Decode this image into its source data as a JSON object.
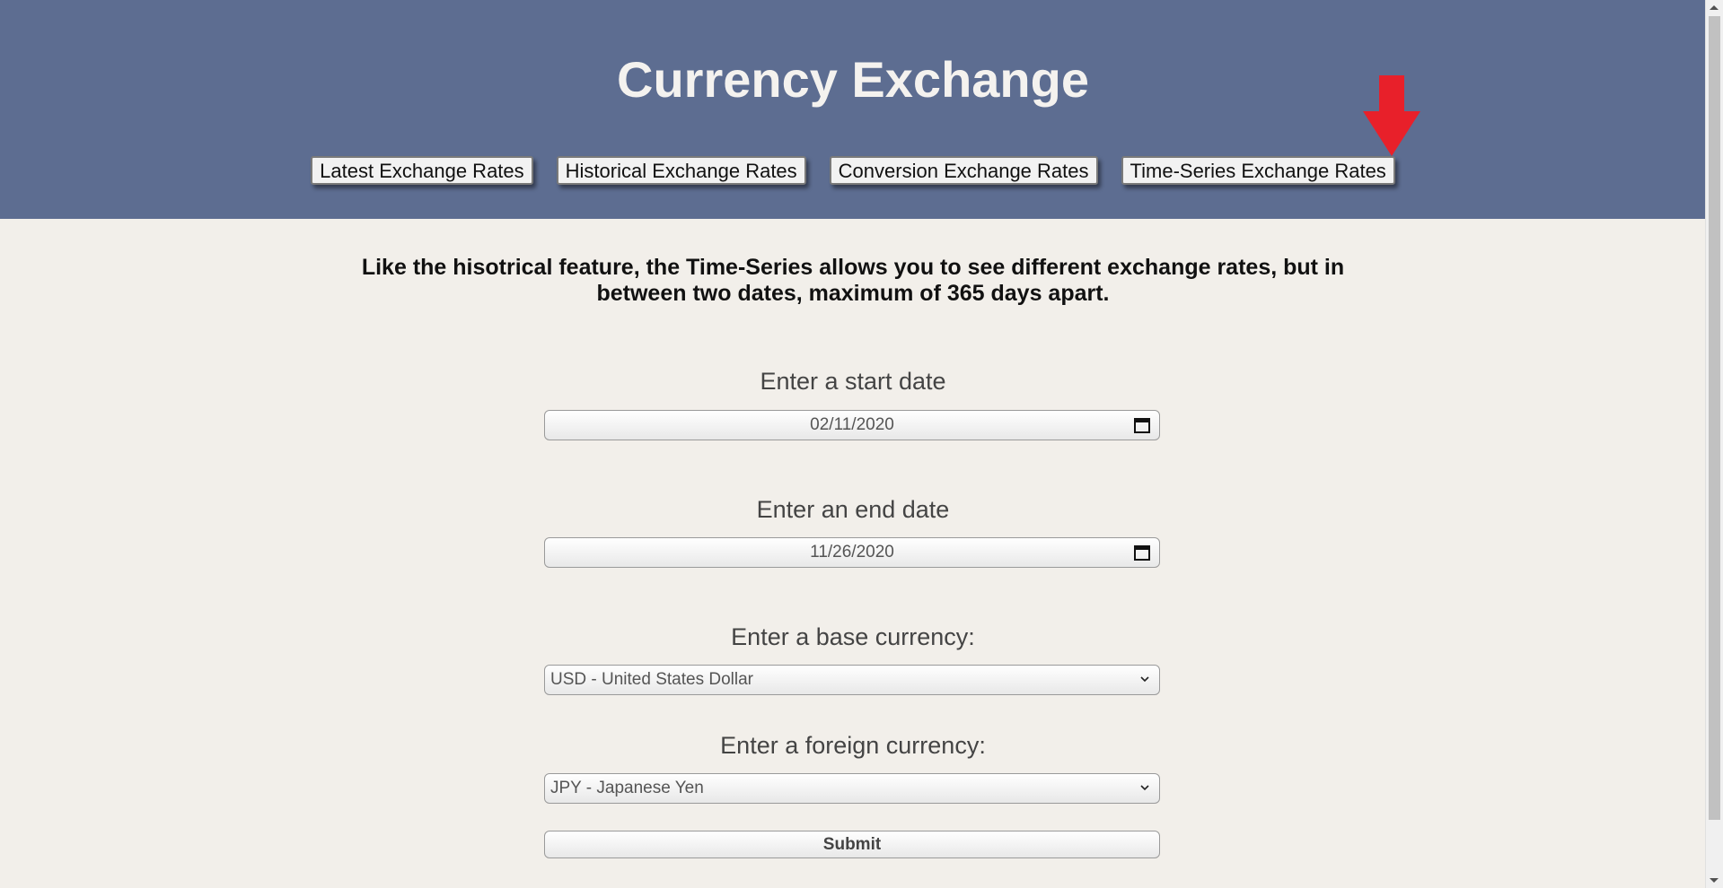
{
  "header": {
    "title": "Currency Exchange",
    "nav": [
      {
        "label": "Latest Exchange Rates"
      },
      {
        "label": "Historical Exchange Rates"
      },
      {
        "label": "Conversion Exchange Rates"
      },
      {
        "label": "Time-Series Exchange Rates"
      }
    ],
    "header_color": "#5d6d91",
    "arrow_color": "#e8202a"
  },
  "main": {
    "description": "Like the hisotrical feature, the Time-Series allows you to see different exchange rates, but in between two dates, maximum of 365 days apart.",
    "start_date": {
      "label": "Enter a start date",
      "value": "02/11/2020"
    },
    "end_date": {
      "label": "Enter an end date",
      "value": "11/26/2020"
    },
    "base_currency": {
      "label": "Enter a base currency:",
      "value": "USD - United States Dollar"
    },
    "foreign_currency": {
      "label": "Enter a foreign currency:",
      "value": "JPY - Japanese Yen"
    },
    "submit_label": "Submit"
  },
  "icons": {
    "calendar": "calendar-icon",
    "dropdown": "chevron-down-icon",
    "annotation_arrow": "arrow-down-icon"
  }
}
